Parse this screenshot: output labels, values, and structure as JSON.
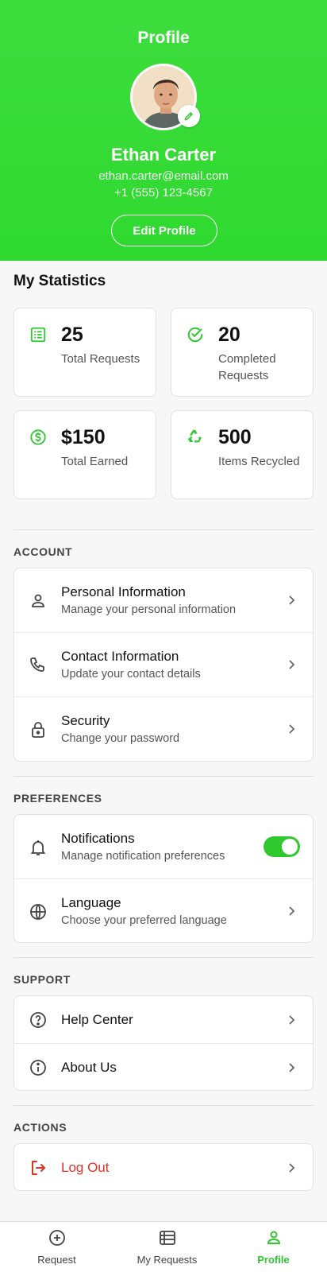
{
  "header": {
    "title": "Profile",
    "name": "Ethan Carter",
    "email": "ethan.carter@email.com",
    "phone": "+1 (555) 123-4567",
    "edit_label": "Edit Profile"
  },
  "statistics": {
    "title": "My Statistics",
    "cards": [
      {
        "value": "25",
        "label": "Total Requests",
        "icon": "list-icon"
      },
      {
        "value": "20",
        "label": "Completed Requests",
        "icon": "check-circle-icon"
      },
      {
        "value": "$150",
        "label": "Total Earned",
        "icon": "dollar-icon"
      },
      {
        "value": "500",
        "label": "Items Recycled",
        "icon": "recycle-icon"
      }
    ]
  },
  "account": {
    "label": "ACCOUNT",
    "items": [
      {
        "title": "Personal Information",
        "subtitle": "Manage your personal information"
      },
      {
        "title": "Contact Information",
        "subtitle": "Update your contact details"
      },
      {
        "title": "Security",
        "subtitle": "Change your password"
      }
    ]
  },
  "preferences": {
    "label": "PREFERENCES",
    "items": [
      {
        "title": "Notifications",
        "subtitle": "Manage notification preferences",
        "enabled": true
      },
      {
        "title": "Language",
        "subtitle": "Choose your preferred language"
      }
    ]
  },
  "support": {
    "label": "SUPPORT",
    "items": [
      {
        "title": "Help Center"
      },
      {
        "title": "About Us"
      }
    ]
  },
  "actions": {
    "label": "ACTIONS",
    "items": [
      {
        "title": "Log Out"
      }
    ]
  },
  "nav": {
    "items": [
      {
        "label": "Request",
        "icon": "plus-circle-icon"
      },
      {
        "label": "My Requests",
        "icon": "list-icon"
      },
      {
        "label": "Profile",
        "icon": "person-icon",
        "active": true
      }
    ]
  },
  "colors": {
    "accent": "#2fc82f",
    "header_bg": "#3edd3e",
    "danger": "#e0302a"
  }
}
